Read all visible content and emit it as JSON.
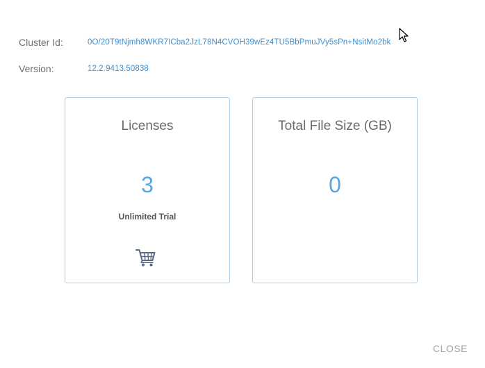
{
  "info": {
    "cluster_id_label": "Cluster Id:",
    "cluster_id_value": "0O/20T9tNjmh8WKR7ICba2JzL78N4CVOH39wEz4TU5BbPmuJVy5sPn+NsitMo2bk",
    "version_label": "Version:",
    "version_value": "12.2.9413.50838"
  },
  "cards": {
    "licenses": {
      "title": "Licenses",
      "value": "3",
      "subtitle": "Unlimited Trial",
      "icon": "shopping-cart-icon"
    },
    "file_size": {
      "title": "Total File Size (GB)",
      "value": "0"
    }
  },
  "footer": {
    "close_label": "CLOSE"
  },
  "colors": {
    "accent": "#3e8fd0",
    "value": "#5aa5dc",
    "card_border": "#a9cde9",
    "muted": "#a3a3a3"
  }
}
